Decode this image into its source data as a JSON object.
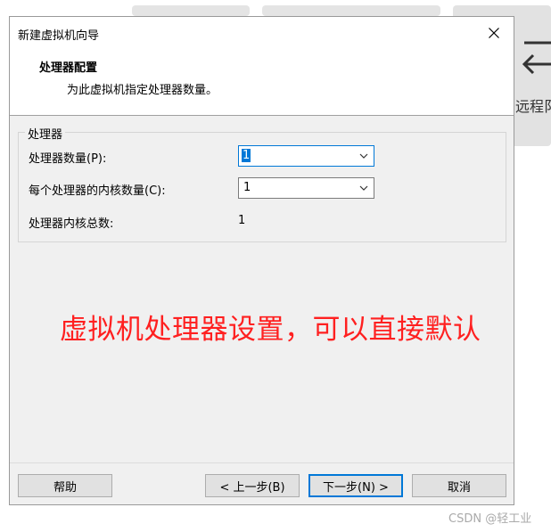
{
  "background": {
    "remote_label": "远程阝"
  },
  "dialog": {
    "title": "新建虚拟机向导",
    "header": {
      "title": "处理器配置",
      "subtitle": "为此虚拟机指定处理器数量。"
    },
    "group": {
      "legend": "处理器",
      "processor_count_label": "处理器数量(P):",
      "processor_count_value": "1",
      "cores_per_processor_label": "每个处理器的内核数量(C):",
      "cores_per_processor_value": "1",
      "total_cores_label": "处理器内核总数:",
      "total_cores_value": "1"
    },
    "annotation": "虚拟机处理器设置，可以直接默认",
    "buttons": {
      "help": "帮助",
      "back": "< 上一步(B)",
      "next": "下一步(N) >",
      "cancel": "取消"
    }
  },
  "watermark": "CSDN @轻工业",
  "colors": {
    "accent": "#0078d7",
    "annotation": "#ff2020",
    "dialog_bg": "#f0f0f0"
  }
}
